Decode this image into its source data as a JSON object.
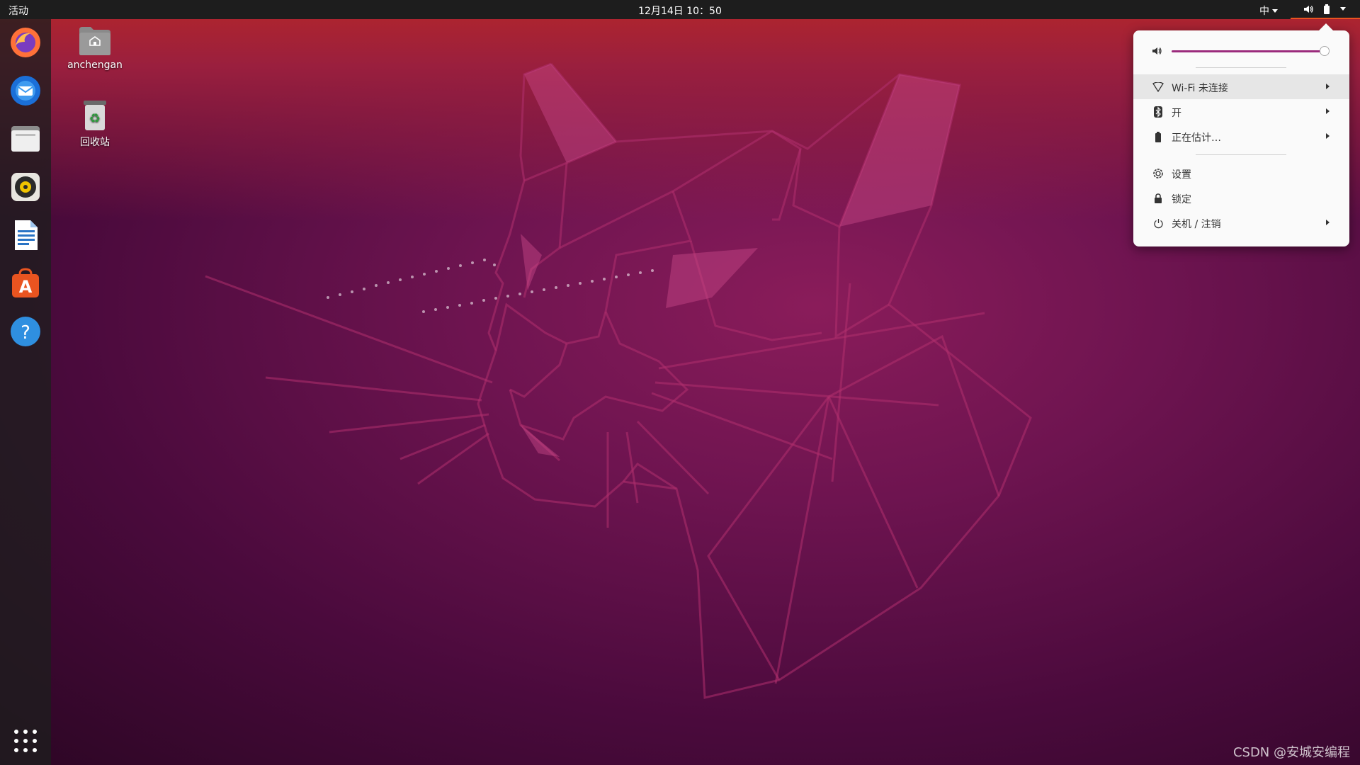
{
  "topbar": {
    "activities": "活动",
    "clock": "12月14日  10：50",
    "ime": "中"
  },
  "desktop": {
    "icons": [
      {
        "label": "anchengan"
      },
      {
        "label": "回收站"
      }
    ]
  },
  "dock": {
    "apps": [
      "firefox-icon",
      "thunderbird-icon",
      "files-icon",
      "rhythmbox-icon",
      "libreoffice-writer-icon",
      "software-icon",
      "help-icon"
    ]
  },
  "system_menu": {
    "volume_level": 0.95,
    "items": [
      {
        "label": "Wi-Fi 未连接",
        "icon": "wifi-icon",
        "submenu": true
      },
      {
        "label": "开",
        "icon": "bluetooth-icon",
        "submenu": true
      },
      {
        "label": "正在估计…",
        "icon": "battery-icon",
        "submenu": true
      },
      {
        "label": "设置",
        "icon": "gear-icon",
        "submenu": false
      },
      {
        "label": "锁定",
        "icon": "lock-icon",
        "submenu": false
      },
      {
        "label": "关机 / 注销",
        "icon": "power-icon",
        "submenu": true
      }
    ]
  },
  "watermark": "CSDN @安城安编程",
  "colors": {
    "accent": "#e95420",
    "slider": "#9b2b7c",
    "menu_bg": "#fafafa"
  }
}
